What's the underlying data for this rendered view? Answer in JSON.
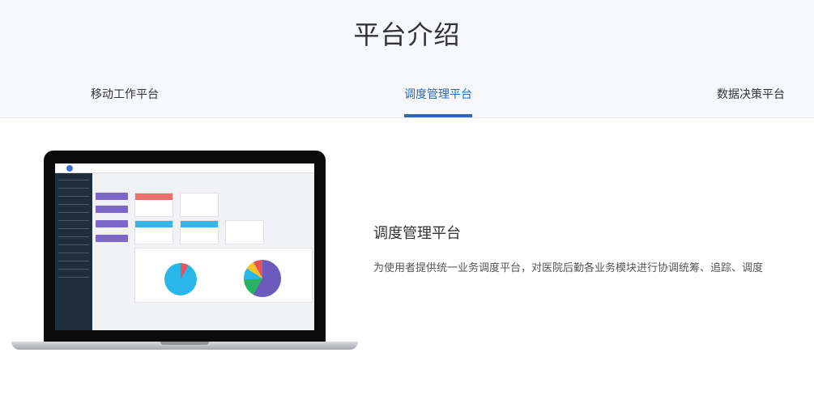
{
  "header": {
    "title": "平台介绍"
  },
  "tabs": [
    {
      "label": "移动工作平台"
    },
    {
      "label": "调度管理平台"
    },
    {
      "label": "数据决策平台"
    }
  ],
  "content": {
    "title": "调度管理平台",
    "description": "为使用者提供统一业务调度平台，对医院后勤各业务模块进行协调统筹、追踪、调度"
  },
  "colors": {
    "accent": "#2f68b6"
  }
}
